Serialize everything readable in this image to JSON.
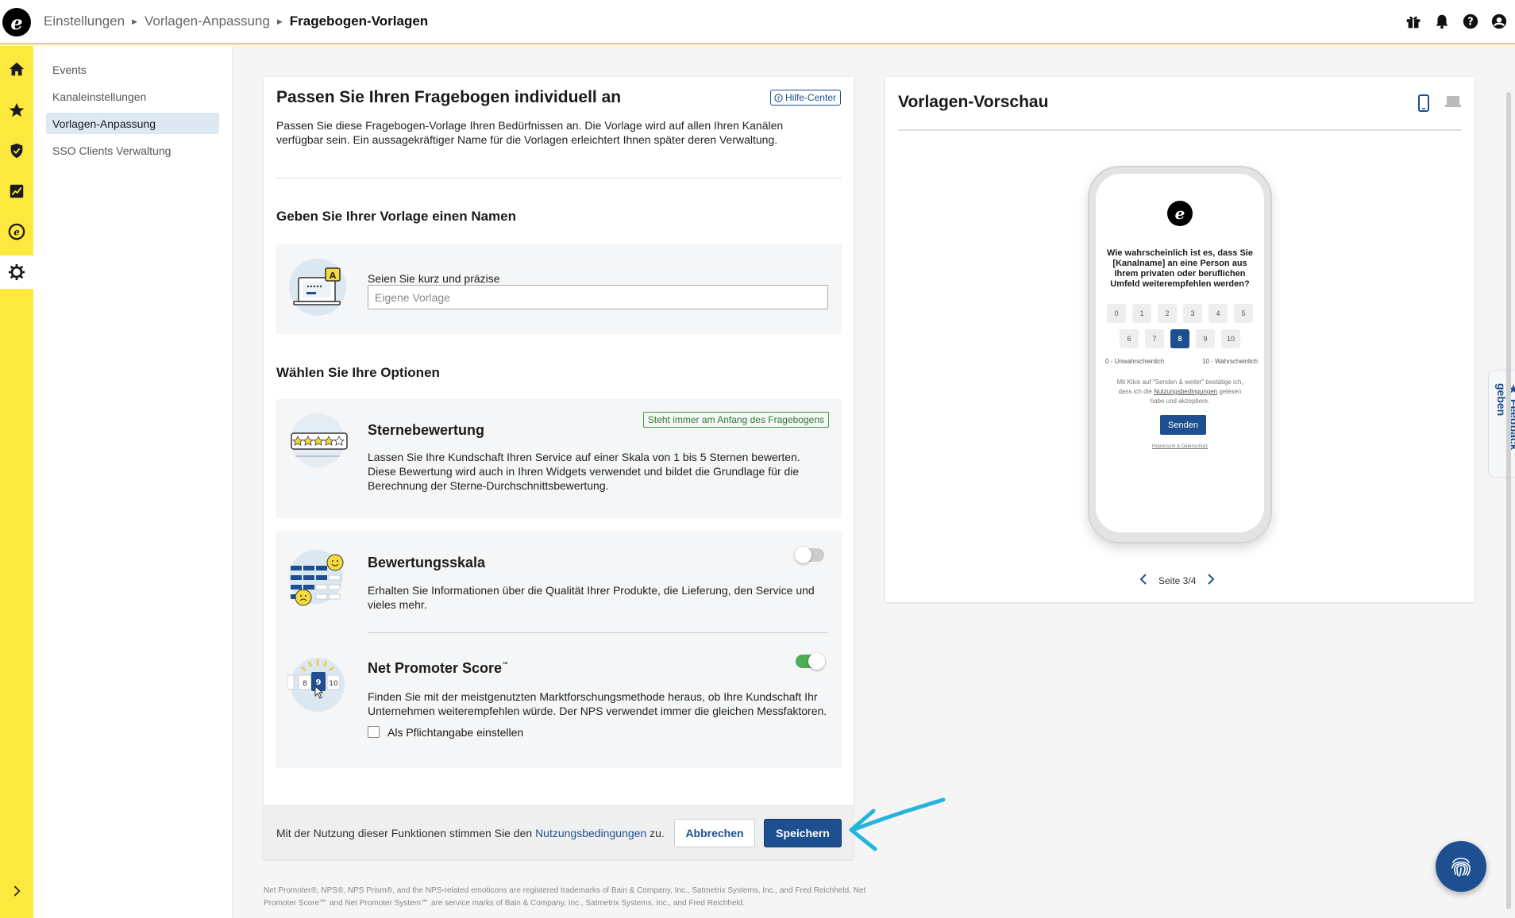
{
  "app": {
    "logo_letter": "e",
    "accent_color": "#1d4f91",
    "nav_color": "#fde93d"
  },
  "breadcrumb": {
    "items": [
      "Einstellungen",
      "Vorlagen-Anpassung"
    ],
    "current": "Fragebogen-Vorlagen"
  },
  "top_icons": [
    "gift-icon",
    "bell-icon",
    "help-icon",
    "user-icon"
  ],
  "left_nav": [
    "home-icon",
    "star-icon",
    "shield-icon",
    "chart-icon",
    "trusted-icon",
    "gear-icon",
    "expand-icon"
  ],
  "subnav": {
    "items": [
      {
        "label": "Events"
      },
      {
        "label": "Kanaleinstellungen"
      },
      {
        "label": "Vorlagen-Anpassung",
        "active": true
      },
      {
        "label": "SSO Clients Verwaltung"
      }
    ]
  },
  "main": {
    "title": "Passen Sie Ihren Fragebogen individuell an",
    "help_label": "Hilfe-Center",
    "intro": "Passen Sie diese Fragebogen-Vorlage Ihren Bedürfnissen an. Die Vorlage wird auf allen Ihren Kanälen verfügbar sein. Ein aussagekräftiger Name für die Vorlagen erleichtert Ihnen später deren Verwaltung.",
    "name_section": {
      "heading": "Geben Sie Ihrer Vorlage einen Namen",
      "field_label": "Seien Sie kurz und präzise",
      "placeholder": "Eigene Vorlage",
      "value": ""
    },
    "options_heading": "Wählen Sie Ihre Optionen",
    "star_rating": {
      "title": "Sternebewertung",
      "tag": "Steht immer am Anfang des Fragebogens",
      "description": "Lassen Sie Ihre Kundschaft Ihren Service auf einer Skala von 1 bis 5 Sternen bewerten. Diese Bewertung wird auch in Ihren Widgets verwendet und bildet die Grundlage für die Berechnung der Sterne-Durchschnittsbewertung."
    },
    "rating_scale": {
      "title": "Bewertungsskala",
      "enabled": false,
      "description": "Erhalten Sie Informationen über die Qualität Ihrer Produkte, die Lieferung, den Service und vieles mehr."
    },
    "nps": {
      "title": "Net Promoter Score",
      "title_mark": "℠",
      "enabled": true,
      "description": "Finden Sie mit der meistgenutzten Marktforschungsmethode heraus, ob Ihre Kundschaft Ihr Unternehmen weiterempfehlen würde. Der NPS verwendet immer die gleichen Messfaktoren.",
      "mandatory_label": "Als Pflichtangabe einstellen",
      "mandatory_checked": false,
      "illus_numbers": [
        "8",
        "9",
        "10"
      ]
    },
    "footer": {
      "text_before": "Mit der Nutzung dieser Funktionen stimmen Sie den",
      "link": "Nutzungsbedingungen",
      "text_after": "zu.",
      "cancel": "Abbrechen",
      "save": "Speichern"
    }
  },
  "legal": "Net Promoter®, NPS®, NPS Prism®, and the NPS-related emoticons are registered trademarks of Bain & Company, Inc., Satmetrix Systems, Inc., and Fred Reichheld. Net Promoter Score℠ and Net Promoter System℠ are service marks of Bain & Company, Inc., Satmetrix Systems, Inc., and Fred Reichheld.",
  "preview": {
    "title": "Vorlagen-Vorschau",
    "device_icons": [
      "phone-icon",
      "laptop-icon"
    ],
    "question": "Wie wahrscheinlich ist es, dass Sie [Kanalname] an eine Person aus Ihrem privaten oder beruflichen Umfeld weiterempfehlen werden?",
    "scores_row1": [
      "0",
      "1",
      "2",
      "3",
      "4",
      "5"
    ],
    "scores_row2": [
      "6",
      "7",
      "8",
      "9",
      "10"
    ],
    "selected_score": "8",
    "low_label": "0 - Unwahrscheinlich",
    "high_label": "10 - Wahrscheinlich",
    "consent_before": "Mit Klick auf \"Senden & weiter\" bestätige ich, dass ich die",
    "consent_link": "Nutzungsbedingungen",
    "consent_after": "gelesen habe und akzeptiere.",
    "send_label": "Senden",
    "imprint": "Impressum & Datenschutz",
    "page_label": "Seite 3/4"
  },
  "feedback_tab": "Feedback geben"
}
